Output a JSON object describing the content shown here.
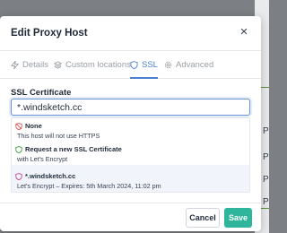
{
  "background": {
    "row_labels": [
      "P",
      "P",
      "P",
      "P"
    ]
  },
  "modal": {
    "title": "Edit Proxy Host",
    "close_glyph": "×"
  },
  "tabs": [
    {
      "label": "Details",
      "icon": "zap-icon",
      "active": false
    },
    {
      "label": "Custom locations",
      "icon": "layers-icon",
      "active": false
    },
    {
      "label": "SSL",
      "icon": "shield-icon",
      "active": true
    },
    {
      "label": "Advanced",
      "icon": "gear-icon",
      "active": false
    }
  ],
  "ssl": {
    "label": "SSL Certificate",
    "value": "*.windsketch.cc",
    "options": [
      {
        "name": "None",
        "sub": "This host will not use HTTPS",
        "icon": "shield-off-icon",
        "color": "#d9534f"
      },
      {
        "name": "Request a new SSL Certificate",
        "sub": "with Let's Encrypt",
        "icon": "shield-icon",
        "color": "#3a9d3a"
      },
      {
        "name": "*.windsketch.cc",
        "sub": "Let's Encrypt – Expires: 5th March 2024, 11:02 pm",
        "icon": "shield-icon",
        "color": "#c2418f"
      }
    ]
  },
  "footer": {
    "cancel": "Cancel",
    "save": "Save"
  },
  "colors": {
    "accent": "#4a7fd0",
    "save": "#2fb59b"
  }
}
